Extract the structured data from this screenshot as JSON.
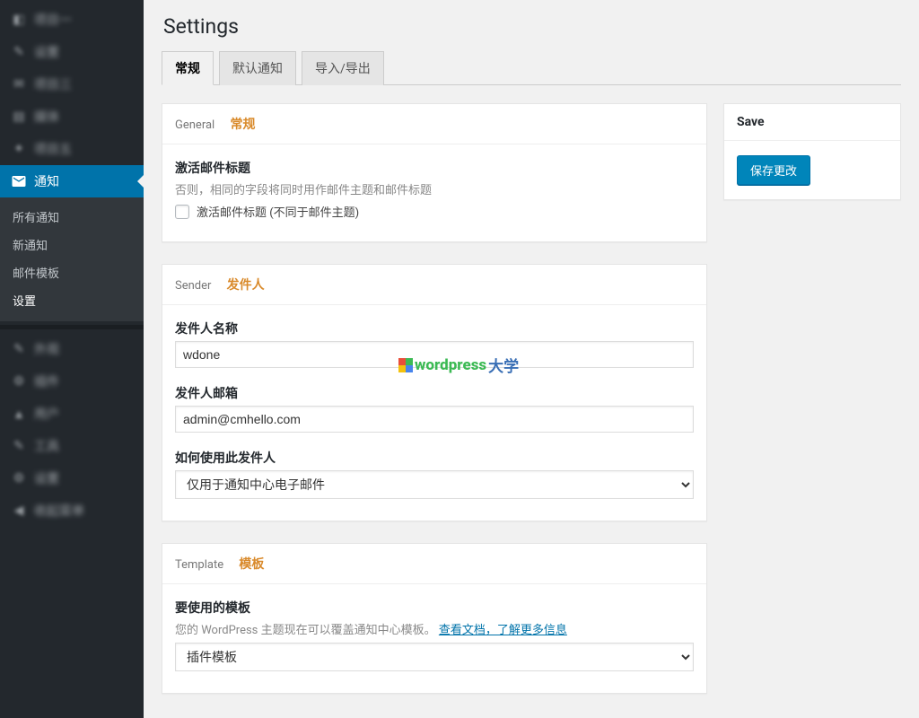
{
  "page_title": "Settings",
  "sidebar": {
    "blurred": [
      "项目一",
      "设置",
      "项目三",
      "媒体",
      "项目五"
    ],
    "active_label": "通知",
    "submenu": [
      "所有通知",
      "新通知",
      "邮件模板",
      "设置"
    ],
    "blurred2": [
      "外观",
      "插件",
      "用户",
      "工具",
      "设置",
      "收起菜单"
    ]
  },
  "tabs": [
    "常规",
    "默认通知",
    "导入/导出"
  ],
  "active_tab_index": 0,
  "general_card": {
    "head_en": "General",
    "head_zh": "常规",
    "field_label": "激活邮件标题",
    "field_help": "否则，相同的字段将同时用作邮件主题和邮件标题",
    "checkbox_label": "激活邮件标题 (不同于邮件主题)"
  },
  "sender_card": {
    "head_en": "Sender",
    "head_zh": "发件人",
    "name_label": "发件人名称",
    "name_value": "wdone",
    "email_label": "发件人邮箱",
    "email_value": "admin@cmhello.com",
    "usage_label": "如何使用此发件人",
    "usage_value": "仅用于通知中心电子邮件"
  },
  "template_card": {
    "head_en": "Template",
    "head_zh": "模板",
    "field_label": "要使用的模板",
    "help_prefix": "您的 WordPress 主题现在可以覆盖通知中心模板。",
    "help_link": "查看文档，了解更多信息",
    "select_value": "插件模板"
  },
  "save_box": {
    "title": "Save",
    "button": "保存更改"
  },
  "watermark": {
    "t1": "wordpress",
    "t2": "大学"
  }
}
